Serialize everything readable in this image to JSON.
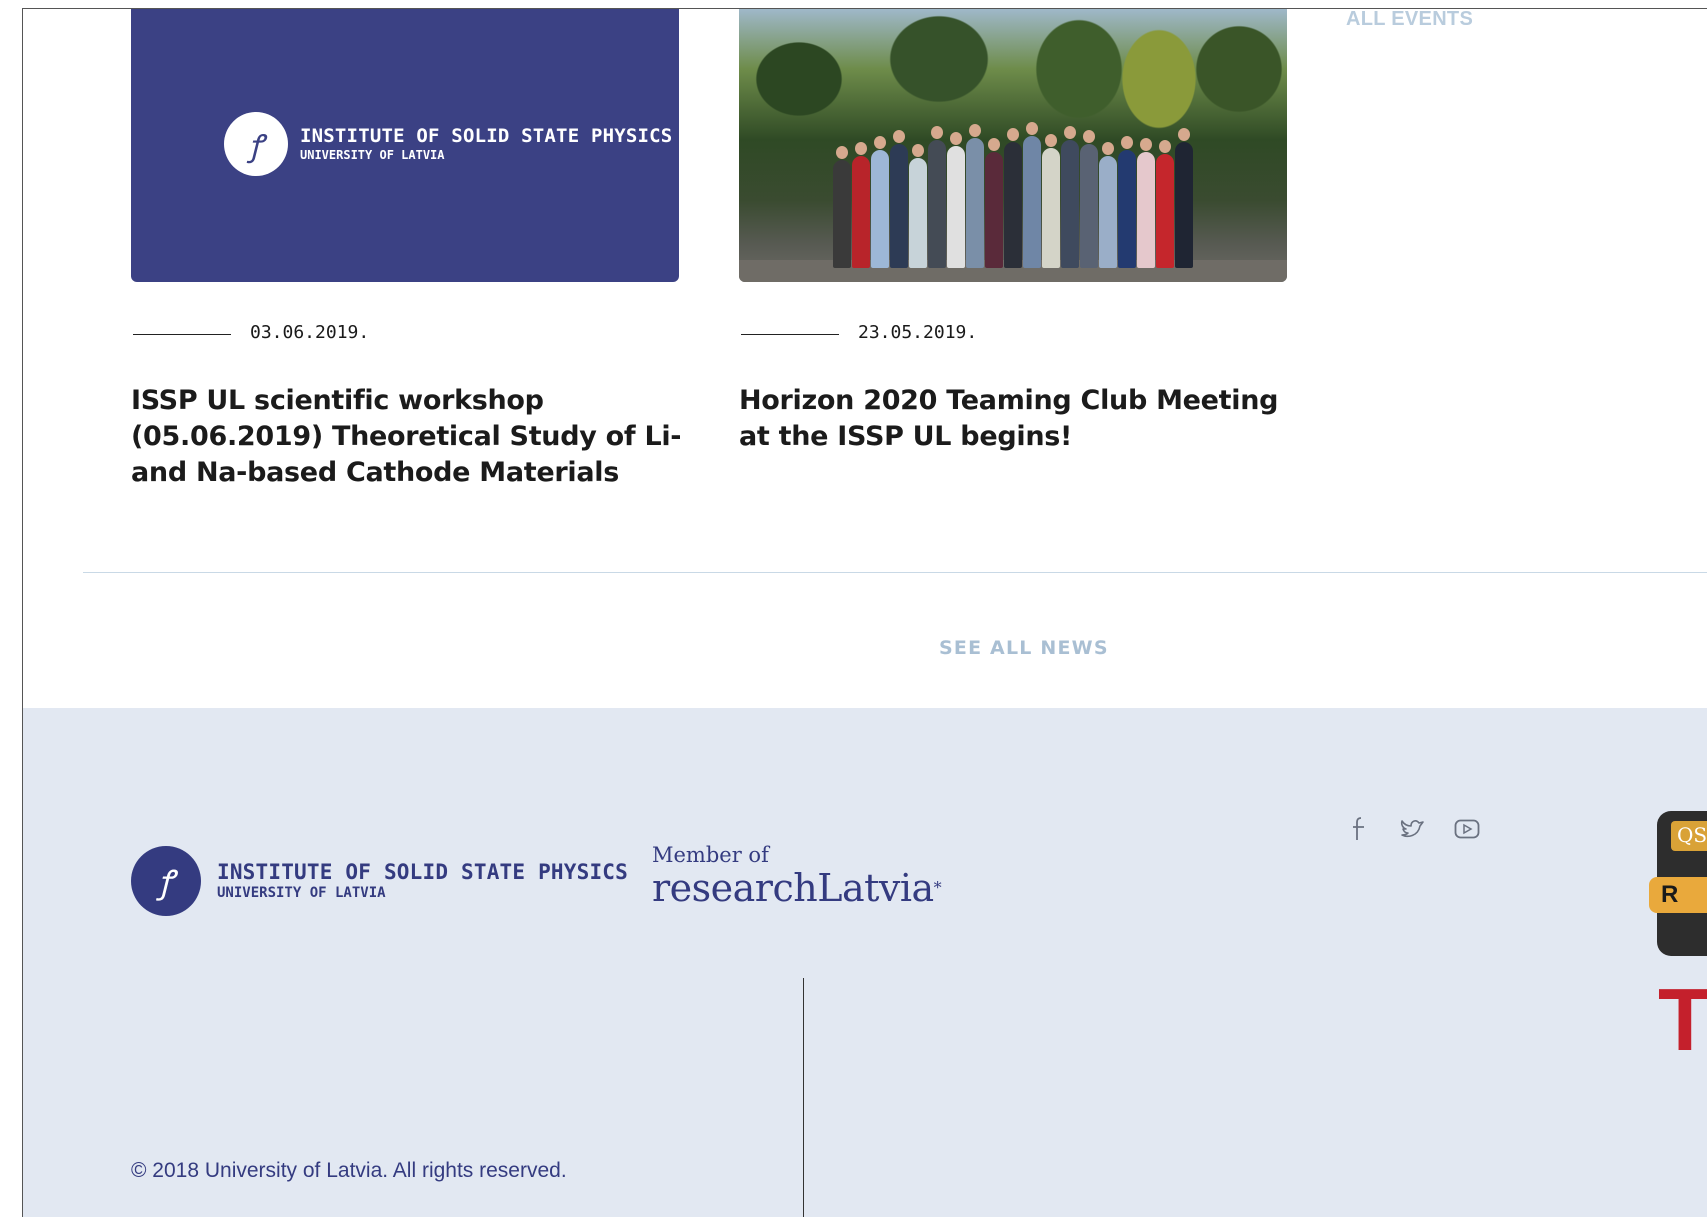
{
  "events": {
    "all_events_label": "ALL EVENTS"
  },
  "news": {
    "see_all_label": "SEE ALL NEWS",
    "items": [
      {
        "image_type": "institute-logo",
        "image_logo_line1": "INSTITUTE OF SOLID STATE PHYSICS",
        "image_logo_line2": "UNIVERSITY OF LATVIA",
        "date": "03.06.2019.",
        "title": "ISSP UL scientific workshop (05.06.2019) Theoretical Study of Li- and Na-based Cathode Materials"
      },
      {
        "image_type": "group-photo",
        "date": "23.05.2019.",
        "title": "Horizon 2020 Teaming Club Meeting at the ISSP UL begins!"
      }
    ]
  },
  "footer": {
    "logo_line1": "INSTITUTE OF SOLID STATE PHYSICS",
    "logo_line2": "UNIVERSITY OF LATVIA",
    "member_prefix": "Member of",
    "member_name": "researchLatvia",
    "member_star": "*",
    "social_icons": [
      "facebook-icon",
      "twitter-icon",
      "youtube-icon"
    ],
    "copyright": "© 2018 University of Latvia. All rights reserved.",
    "badges": {
      "qs_label": "QS",
      "qs_rank_letter": "R",
      "the_label": "TH"
    }
  },
  "colors": {
    "brand_navy": "#3b4184",
    "footer_bg": "#e2e8f2",
    "link_muted": "#a9bfd3"
  }
}
